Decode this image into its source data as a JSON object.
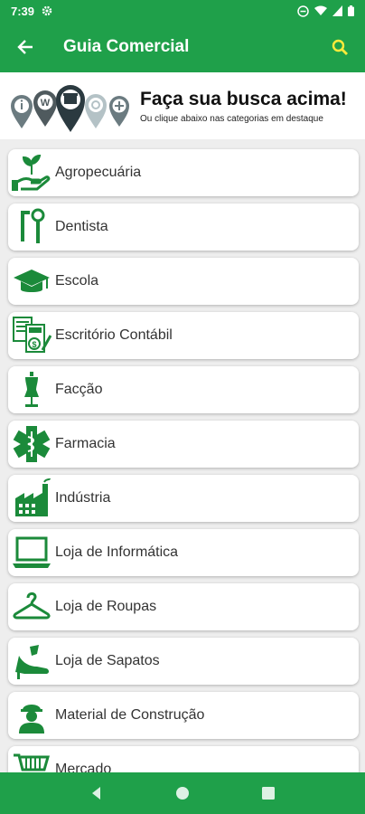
{
  "status_bar": {
    "time": "7:39"
  },
  "app_bar": {
    "title": "Guia Comercial",
    "back_icon": "arrow-left-icon",
    "search_icon": "search-icon",
    "search_color": "#ffeb3b"
  },
  "banner": {
    "headline": "Faça sua busca acima!",
    "subtitle": "Ou clique abaixo nas categorias em destaque"
  },
  "categories": [
    {
      "label": "Agropecuária",
      "icon": "plant-hand-icon"
    },
    {
      "label": "Dentista",
      "icon": "dental-tools-icon"
    },
    {
      "label": "Escola",
      "icon": "graduation-cap-icon"
    },
    {
      "label": "Escritório Contábil",
      "icon": "accounting-icon"
    },
    {
      "label": "Facção",
      "icon": "mannequin-icon"
    },
    {
      "label": "Farmacia",
      "icon": "medical-star-icon"
    },
    {
      "label": "Indústria",
      "icon": "factory-icon"
    },
    {
      "label": "Loja de Informática",
      "icon": "laptop-icon"
    },
    {
      "label": "Loja de Roupas",
      "icon": "hanger-icon"
    },
    {
      "label": "Loja de Sapatos",
      "icon": "high-heel-icon"
    },
    {
      "label": "Material de Construção",
      "icon": "worker-icon"
    },
    {
      "label": "Mercado",
      "icon": "shopping-cart-icon"
    }
  ],
  "colors": {
    "primary": "#1fa04a",
    "icon_green": "#1b8a3a"
  }
}
